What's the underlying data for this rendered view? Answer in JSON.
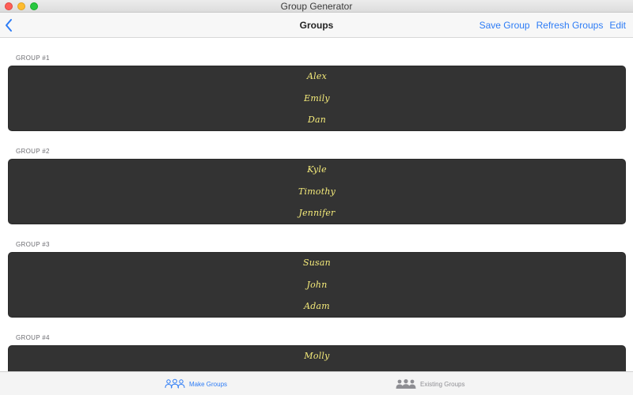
{
  "window": {
    "title": "Group Generator"
  },
  "navbar": {
    "title": "Groups",
    "actions": {
      "save": "Save Group",
      "refresh": "Refresh Groups",
      "edit": "Edit"
    }
  },
  "groups": [
    {
      "header": "GROUP #1",
      "members": [
        "Alex",
        "Emily",
        "Dan"
      ]
    },
    {
      "header": "GROUP #2",
      "members": [
        "Kyle",
        "Timothy",
        "Jennifer"
      ]
    },
    {
      "header": "GROUP #3",
      "members": [
        "Susan",
        "John",
        "Adam"
      ]
    },
    {
      "header": "GROUP #4",
      "members": [
        "Molly"
      ]
    }
  ],
  "tabs": {
    "make": "Make Groups",
    "existing": "Existing Groups"
  },
  "colors": {
    "accent": "#2d7cf6",
    "card": "#333333",
    "member_text": "#f5eb7a"
  }
}
